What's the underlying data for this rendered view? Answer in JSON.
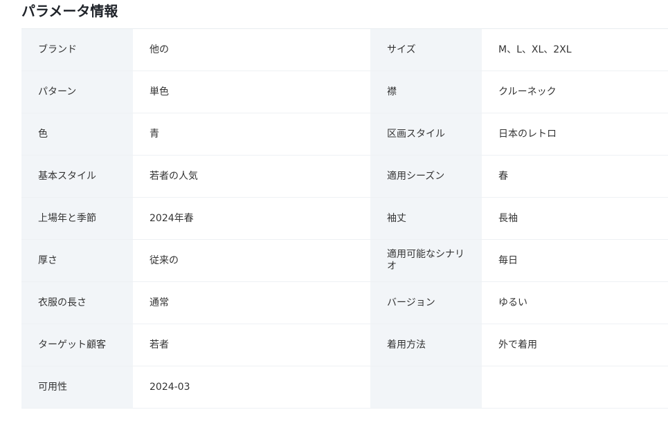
{
  "section": {
    "title": "パラメータ情報"
  },
  "rows": [
    {
      "left_key": "ブランド",
      "left_value": "他の",
      "right_key": "サイズ",
      "right_value": "M、L、XL、2XL"
    },
    {
      "left_key": "パターン",
      "left_value": "単色",
      "right_key": "襟",
      "right_value": "クルーネック"
    },
    {
      "left_key": "色",
      "left_value": "青",
      "right_key": "区画スタイル",
      "right_value": "日本のレトロ"
    },
    {
      "left_key": "基本スタイル",
      "left_value": "若者の人気",
      "right_key": "適用シーズン",
      "right_value": "春"
    },
    {
      "left_key": "上場年と季節",
      "left_value": "2024年春",
      "right_key": "袖丈",
      "right_value": "長袖"
    },
    {
      "left_key": "厚さ",
      "left_value": "従来の",
      "right_key": "適用可能なシナリオ",
      "right_value": "毎日"
    },
    {
      "left_key": "衣服の長さ",
      "left_value": "通常",
      "right_key": "バージョン",
      "right_value": "ゆるい"
    },
    {
      "left_key": "ターゲット顧客",
      "left_value": "若者",
      "right_key": "着用方法",
      "right_value": "外で着用"
    },
    {
      "left_key": "可用性",
      "left_value": "2024-03",
      "right_key": "",
      "right_value": ""
    }
  ]
}
